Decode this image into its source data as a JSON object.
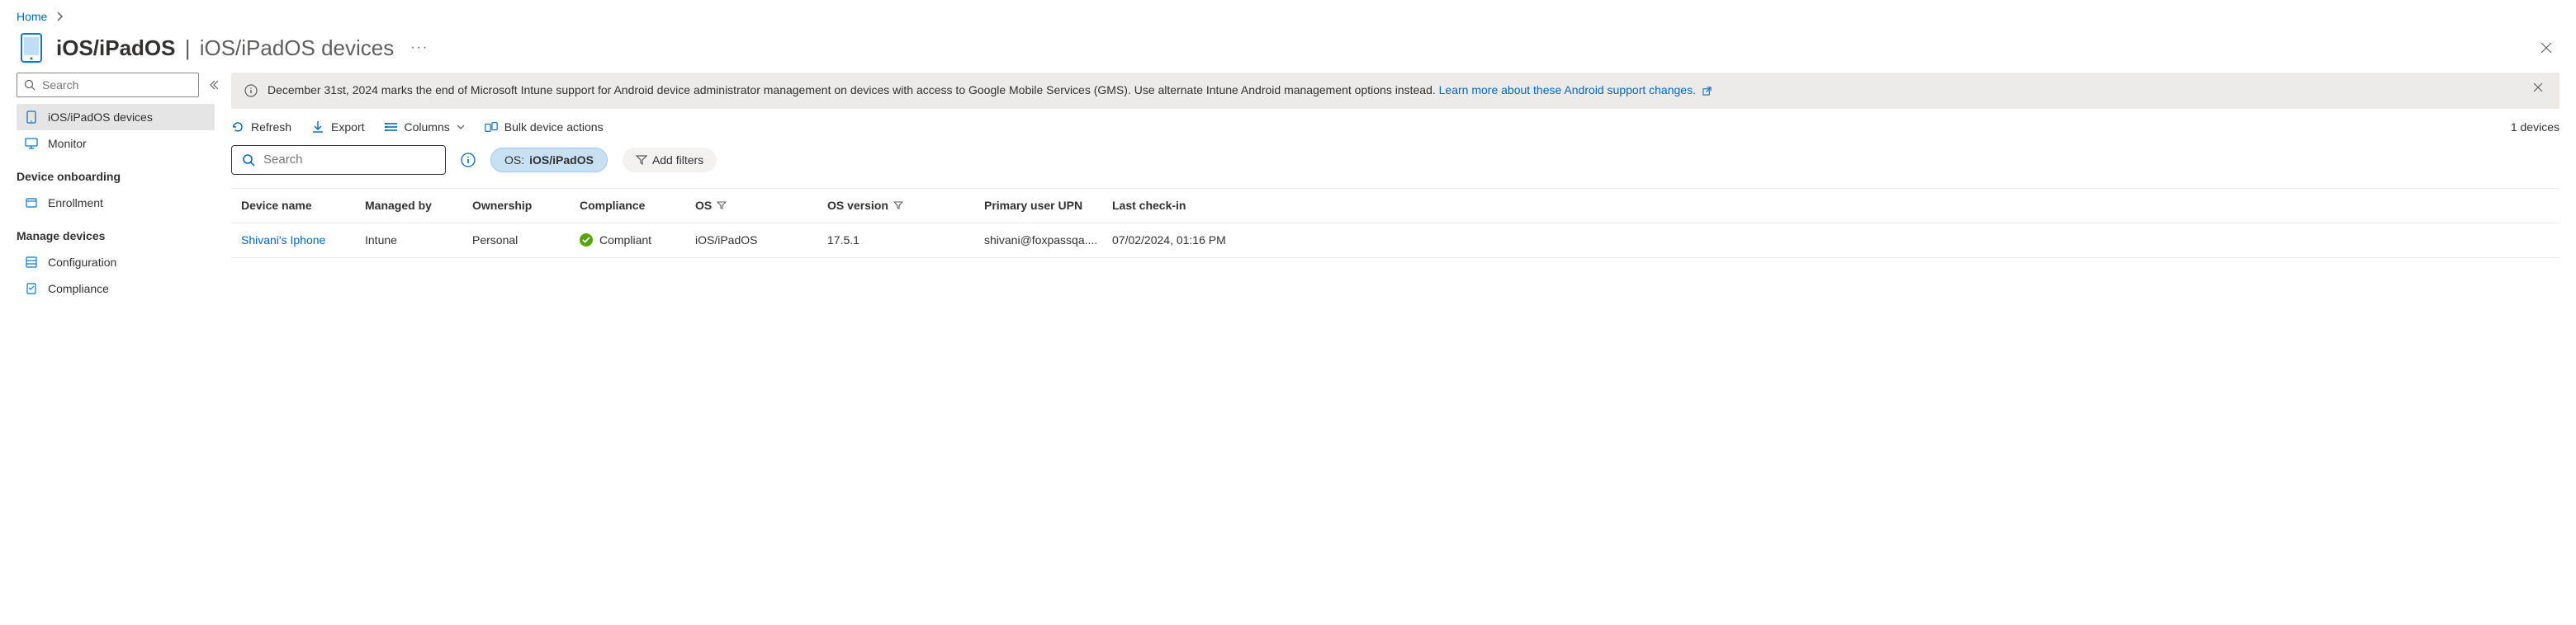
{
  "breadcrumb": {
    "home": "Home"
  },
  "header": {
    "title": "iOS/iPadOS",
    "subtitle": "iOS/iPadOS devices"
  },
  "sidebar": {
    "search_placeholder": "Search",
    "items": [
      {
        "label": "iOS/iPadOS devices",
        "selected": true
      },
      {
        "label": "Monitor",
        "selected": false
      }
    ],
    "section_onboarding": "Device onboarding",
    "onboarding_items": [
      {
        "label": "Enrollment"
      }
    ],
    "section_manage": "Manage devices",
    "manage_items": [
      {
        "label": "Configuration"
      },
      {
        "label": "Compliance"
      }
    ]
  },
  "infobar": {
    "text": "December 31st, 2024 marks the end of Microsoft Intune support for Android device administrator management on devices with access to Google Mobile Services (GMS). Use alternate Intune Android management options instead.",
    "link_text": "Learn more about these Android support changes."
  },
  "commands": {
    "refresh": "Refresh",
    "export": "Export",
    "columns": "Columns",
    "bulk": "Bulk device actions"
  },
  "summary": {
    "device_count": "1 devices"
  },
  "table_filter": {
    "search_placeholder": "Search",
    "os_pill_label": "OS:",
    "os_pill_value": "iOS/iPadOS",
    "add_filters": "Add filters"
  },
  "table": {
    "columns": {
      "device_name": "Device name",
      "managed_by": "Managed by",
      "ownership": "Ownership",
      "compliance": "Compliance",
      "os": "OS",
      "os_version": "OS version",
      "primary_upn": "Primary user UPN",
      "last_checkin": "Last check-in"
    },
    "row": {
      "device_name": "Shivani's Iphone",
      "managed_by": "Intune",
      "ownership": "Personal",
      "compliance": "Compliant",
      "os": "iOS/iPadOS",
      "os_version": "17.5.1",
      "primary_upn": "shivani@foxpassqa....",
      "last_checkin": "07/02/2024, 01:16 PM"
    }
  }
}
